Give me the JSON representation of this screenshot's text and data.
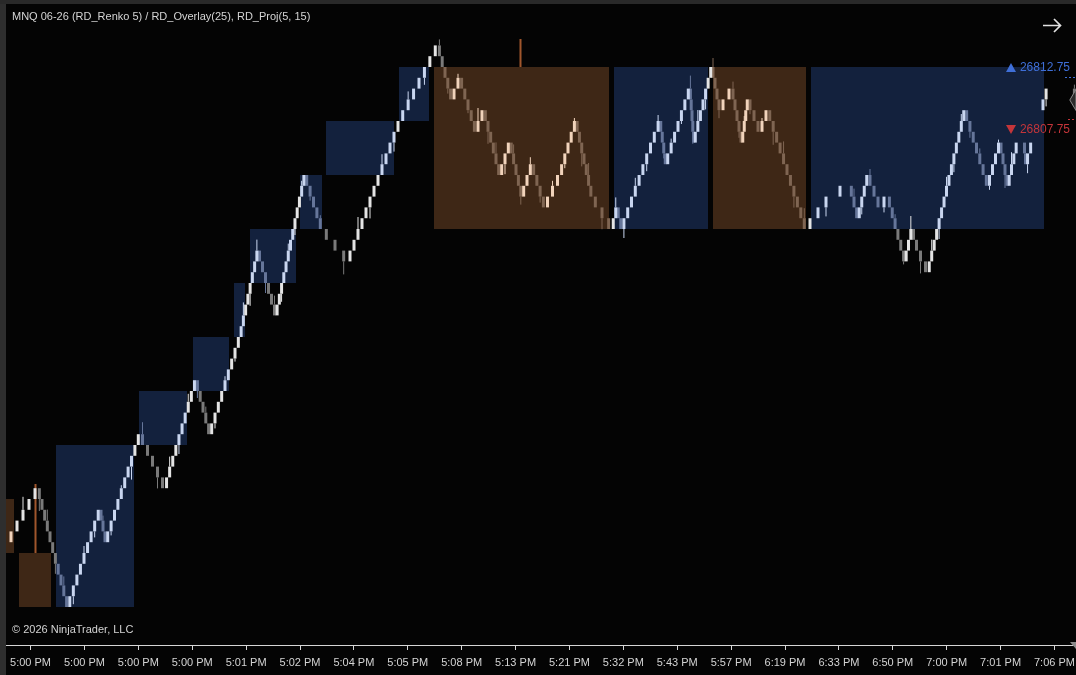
{
  "chart": {
    "title": "MNQ 06-26 (RD_Renko 5) / RD_Overlay(25), RD_Proj(5, 15)",
    "price_markers": [
      {
        "kind": "up",
        "label": "26812.75"
      },
      {
        "kind": "down",
        "label": "26807.75"
      }
    ],
    "copyright": "© 2026 NinjaTrader, LLC"
  },
  "time_axis": {
    "labels": [
      "5:00 PM",
      "5:00 PM",
      "5:00 PM",
      "5:00 PM",
      "5:01 PM",
      "5:02 PM",
      "5:04 PM",
      "5:05 PM",
      "5:08 PM",
      "5:13 PM",
      "5:21 PM",
      "5:32 PM",
      "5:43 PM",
      "5:57 PM",
      "6:19 PM",
      "6:33 PM",
      "6:50 PM",
      "7:00 PM",
      "7:01 PM",
      "7:06 PM"
    ]
  }
}
